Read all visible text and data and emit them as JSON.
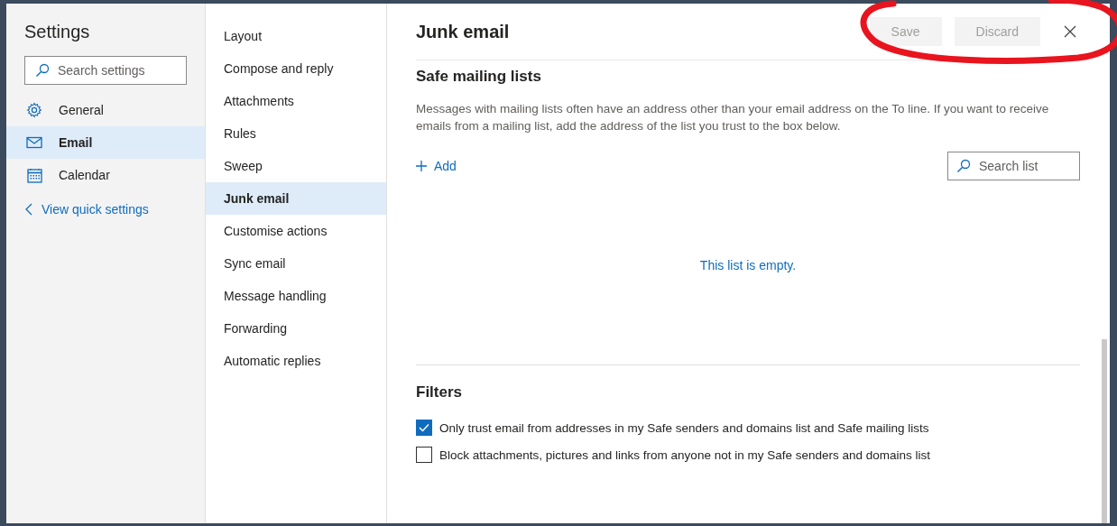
{
  "settings": {
    "title": "Settings",
    "search": {
      "placeholder": "Search settings"
    },
    "categories": [
      {
        "label": "General",
        "kind": "gear",
        "selected": false
      },
      {
        "label": "Email",
        "kind": "mail",
        "selected": true
      },
      {
        "label": "Calendar",
        "kind": "calendar",
        "selected": false
      }
    ],
    "back_link": "View quick settings"
  },
  "subnav": [
    {
      "label": "Layout",
      "selected": false
    },
    {
      "label": "Compose and reply",
      "selected": false
    },
    {
      "label": "Attachments",
      "selected": false
    },
    {
      "label": "Rules",
      "selected": false
    },
    {
      "label": "Sweep",
      "selected": false
    },
    {
      "label": "Junk email",
      "selected": true
    },
    {
      "label": "Customise actions",
      "selected": false
    },
    {
      "label": "Sync email",
      "selected": false
    },
    {
      "label": "Message handling",
      "selected": false
    },
    {
      "label": "Forwarding",
      "selected": false
    },
    {
      "label": "Automatic replies",
      "selected": false
    }
  ],
  "pane": {
    "title": "Junk email",
    "buttons": [
      {
        "label": "Save",
        "disabled": true
      },
      {
        "label": "Discard",
        "disabled": true
      }
    ],
    "section": {
      "title": "Safe mailing lists",
      "description": "Messages with mailing lists often have an address other than your email address on the To line. If you want to receive emails from a mailing list, add the address of the list you trust to the box below.",
      "add": "Add",
      "search": {
        "placeholder": "Search list"
      },
      "empty": "This list is empty."
    },
    "filters": {
      "title": "Filters",
      "options": [
        {
          "label": "Only trust email from addresses in my Safe senders and domains list and Safe mailing lists",
          "checked": true
        },
        {
          "label": "Block attachments, pictures and links from anyone not in my Safe senders and domains list",
          "checked": false
        }
      ]
    }
  }
}
